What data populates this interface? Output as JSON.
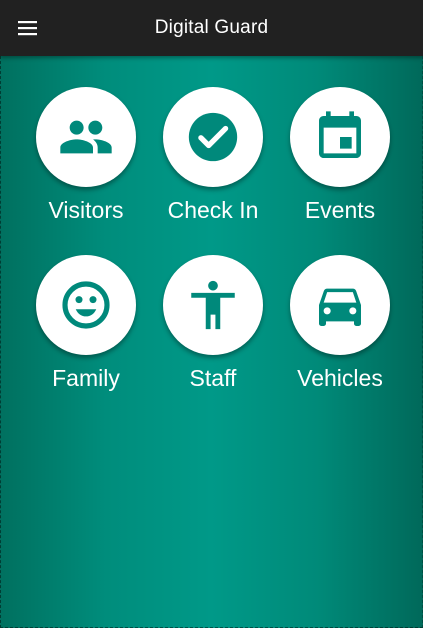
{
  "app_bar": {
    "title": "Digital Guard",
    "menu_icon": "hamburger-menu-icon"
  },
  "colors": {
    "app_bar": "#212121",
    "accent": "#009688",
    "icon": "#00897b",
    "label": "#ffffff"
  },
  "tiles": [
    {
      "label": "Visitors",
      "icon": "people-icon"
    },
    {
      "label": "Check In",
      "icon": "check-circle-icon"
    },
    {
      "label": "Events",
      "icon": "calendar-event-icon"
    },
    {
      "label": "Family",
      "icon": "smiley-face-icon"
    },
    {
      "label": "Staff",
      "icon": "accessibility-person-icon"
    },
    {
      "label": "Vehicles",
      "icon": "car-icon"
    }
  ]
}
